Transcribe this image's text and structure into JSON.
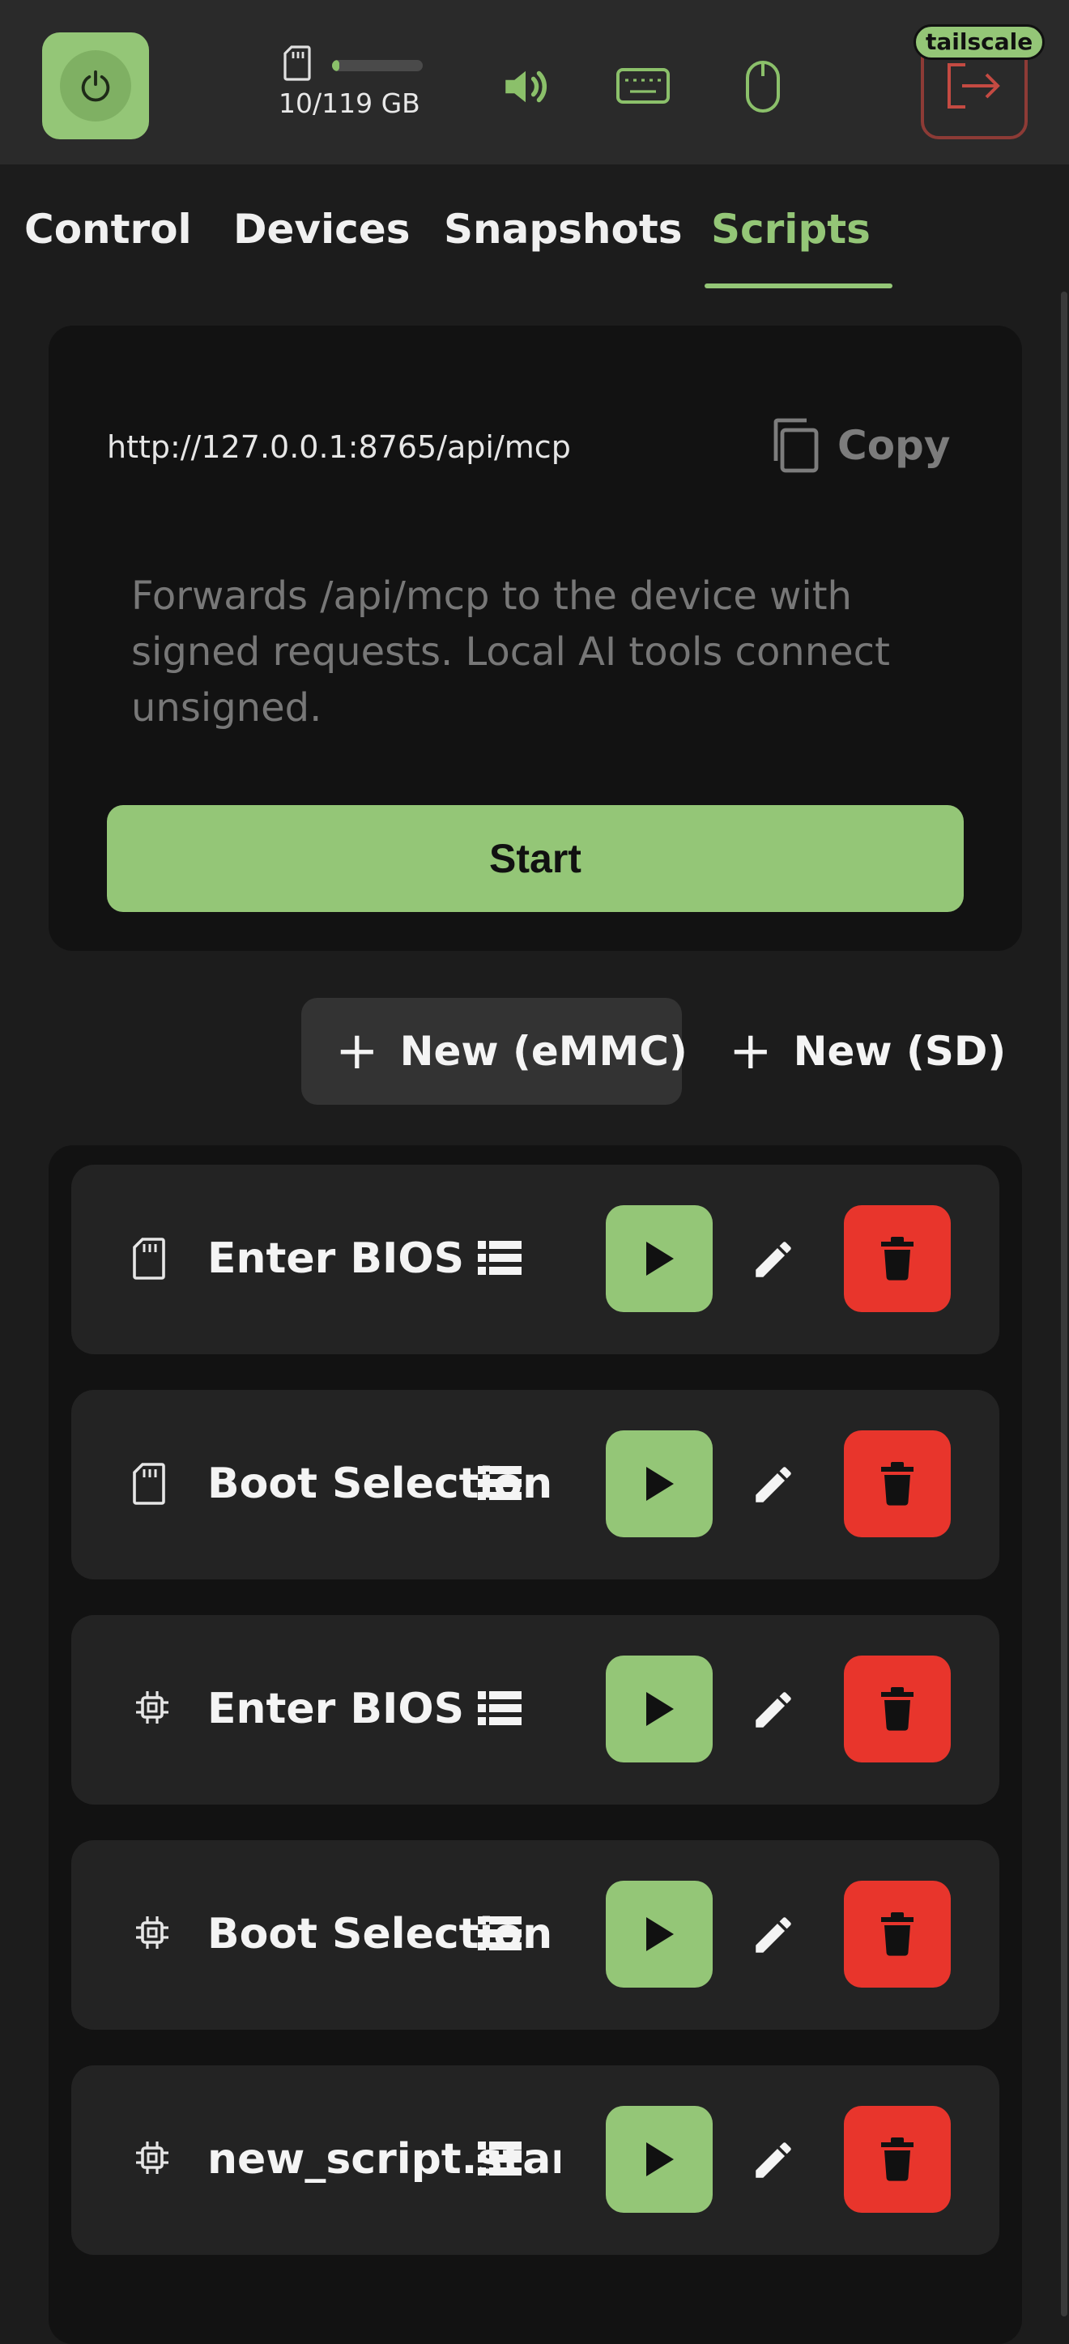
{
  "topbar": {
    "storage": {
      "label": "10/119 GB",
      "used_fraction": 0.084
    },
    "tailscale_badge": "tailscale"
  },
  "tabs": [
    {
      "label": "Control",
      "active": false
    },
    {
      "label": "Devices",
      "active": false
    },
    {
      "label": "Snapshots",
      "active": false
    },
    {
      "label": "Scripts",
      "active": true
    }
  ],
  "mcp": {
    "url": "http://127.0.0.1:8765/api/mcp",
    "copy_label": "Copy",
    "description": "Forwards /api/mcp to the device with signed requests. Local AI tools connect unsigned.",
    "start_label": "Start"
  },
  "actions": {
    "new_emmc_label": "New (eMMC)",
    "new_sd_label": "New (SD)"
  },
  "scripts": [
    {
      "name": "Enter BIOS",
      "storage_icon": "sd-card-icon"
    },
    {
      "name": "Boot Selection",
      "storage_icon": "sd-card-icon"
    },
    {
      "name": "Enter BIOS",
      "storage_icon": "chip-icon"
    },
    {
      "name": "Boot Selection",
      "storage_icon": "chip-icon"
    },
    {
      "name": "new_script.star",
      "storage_icon": "chip-icon"
    }
  ],
  "colors": {
    "accent": "#94c677",
    "danger": "#e8352c",
    "background": "#1c1c1c",
    "card": "#121212"
  }
}
